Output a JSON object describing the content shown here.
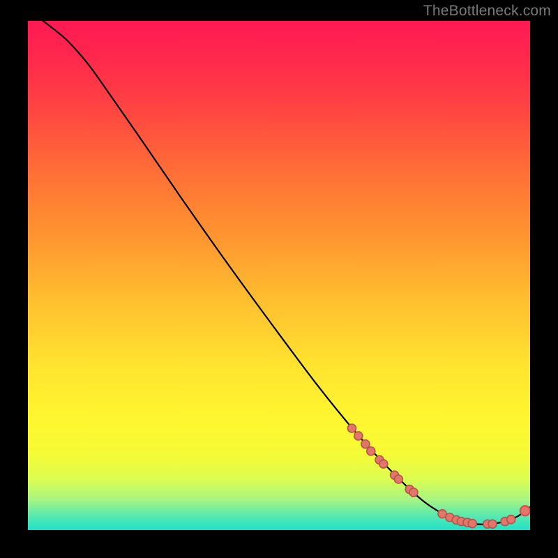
{
  "watermark": "TheBottleneck.com",
  "colors": {
    "marker_fill": "#e2766b",
    "marker_stroke": "#b5534a",
    "marker_stroke_highlight": "#e14c4f",
    "curve": "#000000"
  },
  "chart_data": {
    "type": "line",
    "title": "",
    "xlabel": "",
    "ylabel": "",
    "xlim": [
      0,
      100
    ],
    "ylim": [
      0,
      100
    ],
    "gradient_stops": [
      {
        "offset": 0.0,
        "color": "#ff1953"
      },
      {
        "offset": 0.08,
        "color": "#ff2a4c"
      },
      {
        "offset": 0.18,
        "color": "#ff4741"
      },
      {
        "offset": 0.3,
        "color": "#ff7036"
      },
      {
        "offset": 0.42,
        "color": "#ff9430"
      },
      {
        "offset": 0.55,
        "color": "#ffbf2f"
      },
      {
        "offset": 0.68,
        "color": "#ffe42f"
      },
      {
        "offset": 0.78,
        "color": "#fff62f"
      },
      {
        "offset": 0.85,
        "color": "#f5fb36"
      },
      {
        "offset": 0.9,
        "color": "#dcfd51"
      },
      {
        "offset": 0.94,
        "color": "#a7f581"
      },
      {
        "offset": 0.97,
        "color": "#5de9ad"
      },
      {
        "offset": 1.0,
        "color": "#1fe1c8"
      }
    ],
    "curve": [
      {
        "x": 3.0,
        "y": 100.0
      },
      {
        "x": 5.0,
        "y": 98.5
      },
      {
        "x": 8.0,
        "y": 96.0
      },
      {
        "x": 12.0,
        "y": 91.5
      },
      {
        "x": 16.0,
        "y": 86.0
      },
      {
        "x": 22.0,
        "y": 77.5
      },
      {
        "x": 30.0,
        "y": 66.0
      },
      {
        "x": 40.0,
        "y": 52.0
      },
      {
        "x": 50.0,
        "y": 38.5
      },
      {
        "x": 58.0,
        "y": 28.0
      },
      {
        "x": 65.0,
        "y": 19.5
      },
      {
        "x": 70.0,
        "y": 14.0
      },
      {
        "x": 75.0,
        "y": 9.0
      },
      {
        "x": 79.0,
        "y": 5.5
      },
      {
        "x": 83.0,
        "y": 3.0
      },
      {
        "x": 86.0,
        "y": 1.8
      },
      {
        "x": 89.0,
        "y": 1.2
      },
      {
        "x": 92.0,
        "y": 1.2
      },
      {
        "x": 95.0,
        "y": 1.7
      },
      {
        "x": 97.5,
        "y": 2.7
      },
      {
        "x": 100.0,
        "y": 4.5
      }
    ],
    "markers": [
      {
        "x": 64.5,
        "y": 20.0,
        "r": 6
      },
      {
        "x": 65.8,
        "y": 18.5,
        "r": 6
      },
      {
        "x": 67.2,
        "y": 16.9,
        "r": 6
      },
      {
        "x": 68.3,
        "y": 15.5,
        "r": 6
      },
      {
        "x": 70.0,
        "y": 13.8,
        "r": 6
      },
      {
        "x": 70.8,
        "y": 13.0,
        "r": 6
      },
      {
        "x": 73.0,
        "y": 10.8,
        "r": 6
      },
      {
        "x": 73.8,
        "y": 10.0,
        "r": 6
      },
      {
        "x": 76.0,
        "y": 8.0,
        "r": 6
      },
      {
        "x": 76.8,
        "y": 7.4,
        "r": 6
      },
      {
        "x": 82.5,
        "y": 3.2,
        "r": 6
      },
      {
        "x": 84.0,
        "y": 2.5,
        "r": 6
      },
      {
        "x": 85.3,
        "y": 2.0,
        "r": 6
      },
      {
        "x": 86.3,
        "y": 1.7,
        "r": 6
      },
      {
        "x": 87.5,
        "y": 1.5,
        "r": 6
      },
      {
        "x": 88.5,
        "y": 1.3,
        "r": 6
      },
      {
        "x": 91.5,
        "y": 1.2,
        "r": 6
      },
      {
        "x": 92.5,
        "y": 1.2,
        "r": 6
      },
      {
        "x": 95.0,
        "y": 1.7,
        "r": 6
      },
      {
        "x": 96.2,
        "y": 2.1,
        "r": 6
      },
      {
        "x": 99.0,
        "y": 3.8,
        "r": 7,
        "highlight": true
      }
    ]
  }
}
